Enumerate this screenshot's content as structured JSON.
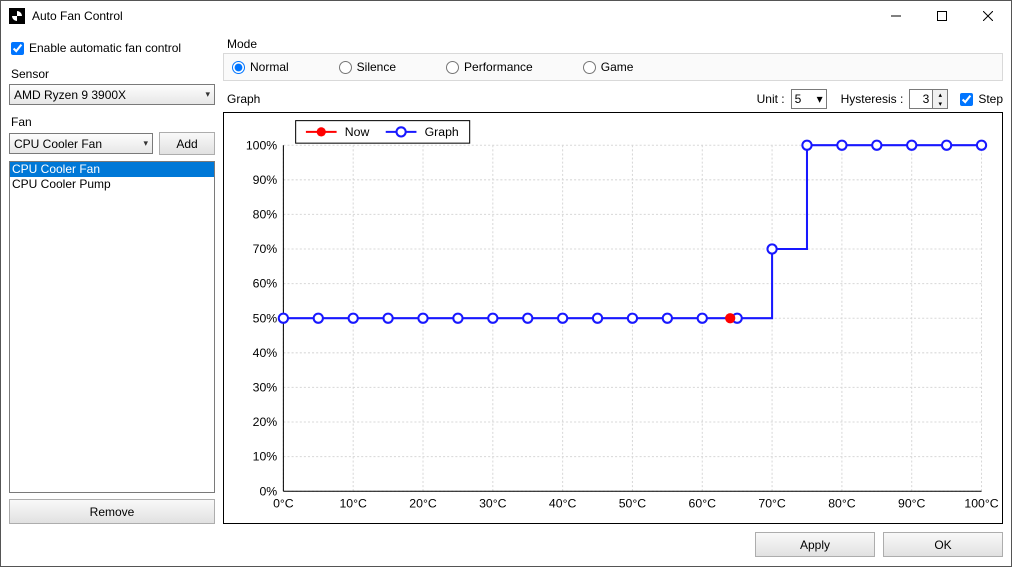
{
  "window": {
    "title": "Auto Fan Control"
  },
  "enable": {
    "label": "Enable automatic fan control",
    "checked": true
  },
  "sensor": {
    "label": "Sensor",
    "value": "AMD Ryzen 9 3900X"
  },
  "fan": {
    "label": "Fan",
    "value": "CPU Cooler Fan",
    "add": "Add",
    "remove": "Remove",
    "list": [
      "CPU Cooler Fan",
      "CPU Cooler Pump"
    ],
    "selected": 0
  },
  "mode": {
    "label": "Mode",
    "options": [
      "Normal",
      "Silence",
      "Performance",
      "Game"
    ],
    "selected": 0
  },
  "graph": {
    "label": "Graph",
    "unit_label": "Unit :",
    "unit": "5",
    "hyst_label": "Hysteresis :",
    "hyst": "3",
    "step_label": "Step",
    "step": true,
    "legend": {
      "now": "Now",
      "graph": "Graph"
    }
  },
  "footer": {
    "apply": "Apply",
    "ok": "OK"
  },
  "chart_data": {
    "type": "line",
    "xlabel": "",
    "ylabel": "",
    "xlim": [
      0,
      100
    ],
    "ylim": [
      0,
      100
    ],
    "x_ticks": [
      0,
      10,
      20,
      30,
      40,
      50,
      60,
      70,
      80,
      90,
      100
    ],
    "y_ticks": [
      0,
      10,
      20,
      30,
      40,
      50,
      60,
      70,
      80,
      90,
      100
    ],
    "x_unit": "°C",
    "y_unit": "%",
    "series": [
      {
        "name": "Graph",
        "color": "#1818ff",
        "step": true,
        "x": [
          0,
          5,
          10,
          15,
          20,
          25,
          30,
          35,
          40,
          45,
          50,
          55,
          60,
          65,
          70,
          75,
          80,
          85,
          90,
          95,
          100
        ],
        "y": [
          50,
          50,
          50,
          50,
          50,
          50,
          50,
          50,
          50,
          50,
          50,
          50,
          50,
          50,
          70,
          100,
          100,
          100,
          100,
          100,
          100
        ]
      }
    ],
    "now": {
      "x": 64,
      "y": 50,
      "color": "#ff0000"
    }
  }
}
